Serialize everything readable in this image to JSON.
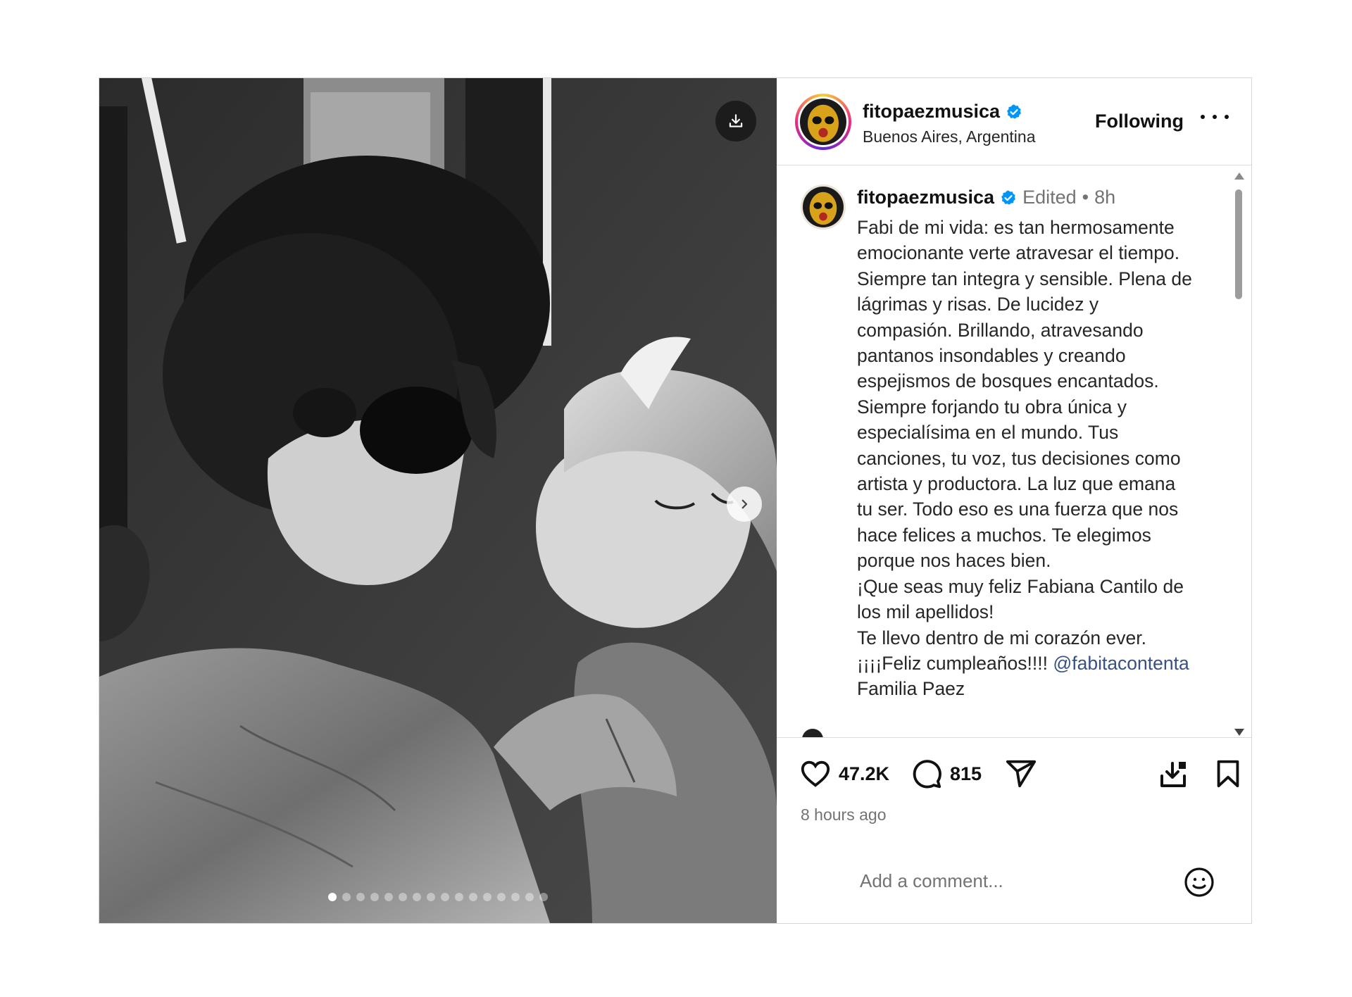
{
  "post": {
    "media": {
      "description_icon": "download-icon",
      "next_icon": "chevron-right-icon",
      "slide_count": 16,
      "active_slide": 1
    },
    "header": {
      "username": "fitopaezmusica",
      "verified": true,
      "location": "Buenos Aires, Argentina",
      "follow_label": "Following",
      "more_icon": "more-horizontal-icon"
    },
    "caption": {
      "username": "fitopaezmusica",
      "edited_label": "Edited",
      "separator": "•",
      "age": "8h",
      "lines": [
        "Fabi de mi vida: es tan hermosamente",
        "emocionante verte atravesar el tiempo.",
        "Siempre tan integra y sensible. Plena de",
        "lágrimas y risas. De lucidez y",
        "compasión. Brillando, atravesando",
        "pantanos insondables y creando",
        "espejismos de bosques encantados.",
        "Siempre forjando tu obra única y",
        "especialísima en el mundo. Tus",
        "canciones, tu voz, tus decisiones como",
        "artista y productora. La luz que emana",
        "tu ser. Todo eso es una fuerza que nos",
        "hace felices a muchos. Te elegimos",
        "porque nos haces bien.",
        "¡Que seas muy feliz Fabiana Cantilo de",
        "los mil apellidos!",
        "Te llevo dentro de mi corazón ever."
      ],
      "birthday_text": "¡¡¡¡Feliz cumpleaños!!!! ",
      "mention": "@fabitacontenta",
      "signature": "Familia Paez"
    },
    "actions": {
      "likes": "47.2K",
      "comments": "815",
      "like_icon": "heart-icon",
      "comment_icon": "comment-icon",
      "share_icon": "send-icon",
      "download_icon": "download-icon",
      "save_icon": "bookmark-icon",
      "time_ago": "8 hours ago"
    },
    "comment": {
      "placeholder": "Add a comment...",
      "emoji_icon": "emoji-icon"
    },
    "colors": {
      "verified": "#0095f6",
      "mention": "#385185",
      "muted": "#737373"
    }
  }
}
